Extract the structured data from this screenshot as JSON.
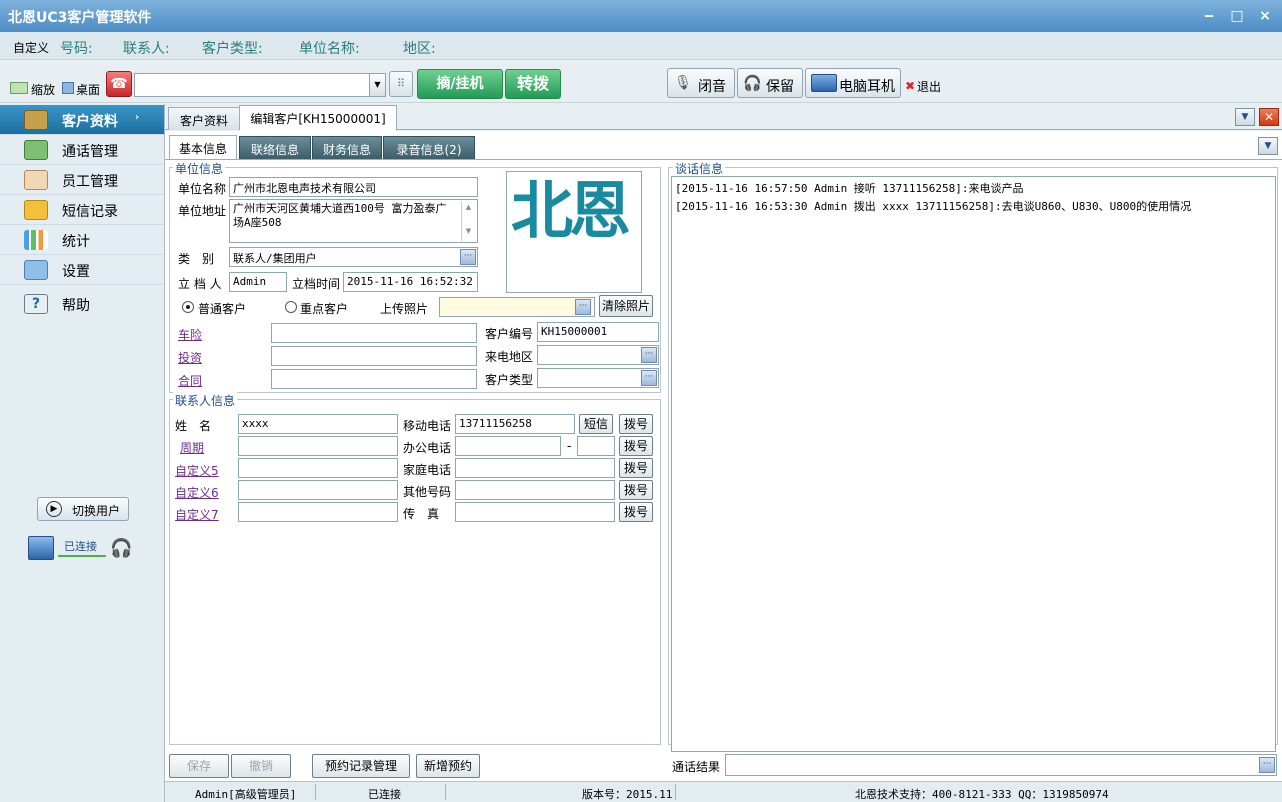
{
  "app": {
    "title": "北恩UC3客户管理软件"
  },
  "window_controls": {
    "minimize": "‒",
    "maximize": "□",
    "close": "×"
  },
  "query_bar": {
    "custom_label": "自定义",
    "fields": [
      "号码:",
      "联系人:",
      "客户类型:",
      "单位名称:",
      "地区:"
    ]
  },
  "toolbar": {
    "zoom_label": "缩放",
    "desktop_label": "桌面",
    "dial_value": "",
    "pickup_hangup": "摘/挂机",
    "transfer": "转拨",
    "mute": "闭音",
    "hold": "保留",
    "pc_headset": "电脑耳机",
    "exit": "退出"
  },
  "sidebar": {
    "items": [
      {
        "label": "客户资料",
        "icon": "customer-card-icon",
        "active": true
      },
      {
        "label": "通话管理",
        "icon": "call-management-icon"
      },
      {
        "label": "员工管理",
        "icon": "staff-icon"
      },
      {
        "label": "短信记录",
        "icon": "envelope-icon"
      },
      {
        "label": "统计",
        "icon": "bar-chart-icon"
      },
      {
        "label": "设置",
        "icon": "settings-icon"
      },
      {
        "label": "帮助",
        "icon": "help-icon"
      }
    ],
    "switch_user": "切换用户",
    "connection_status": "已连接"
  },
  "doc_tabs": [
    "客户资料",
    "编辑客户[KH15000001]"
  ],
  "sub_tabs": [
    "基本信息",
    "联络信息",
    "财务信息",
    "录音信息(2)"
  ],
  "unit_info": {
    "title": "单位信息",
    "unit_name_label": "单位名称",
    "unit_name": "广州市北恩电声技术有限公司",
    "address_label": "单位地址",
    "address": "广州市天河区黄埔大道西100号 富力盈泰广场A座508",
    "category_label": "类　别",
    "category": "联系人/集团用户",
    "creator_label": "立 档 人",
    "creator": "Admin",
    "created_time_label": "立档时间",
    "created_time": "2015-11-16 16:52:32",
    "logo_text": "北恩",
    "radio_normal": "普通客户",
    "radio_key": "重点客户",
    "upload_photo_label": "上传照片",
    "clear_photo": "清除照片",
    "link_car_insurance": "车险",
    "link_investment": "投资",
    "link_contract": "合同",
    "customer_no_label": "客户编号",
    "customer_no": "KH15000001",
    "caller_area_label": "来电地区",
    "customer_type_label": "客户类型"
  },
  "contact_info": {
    "title": "联系人信息",
    "name_label": "姓　名",
    "name": "xxxx",
    "mobile_label": "移动电话",
    "mobile": "13711156258",
    "sms_button": "短信",
    "dial_button": "拨号",
    "cycle_label": "周期",
    "office_label": "办公电话",
    "dash": "-",
    "custom5_label": "自定义5",
    "home_label": "家庭电话",
    "custom6_label": "自定义6",
    "other_label": "其他号码",
    "custom7_label": "自定义7",
    "fax_label": "传　真"
  },
  "conversation": {
    "title": "谈话信息",
    "lines": [
      "[2015-11-16 16:57:50 Admin 接听  13711156258]:来电谈产品",
      "[2015-11-16 16:53:30 Admin 拨出 xxxx 13711156258]:去电谈U860、U830、U800的使用情况"
    ],
    "call_result_label": "通话结果"
  },
  "bottom_buttons": {
    "save": "保存",
    "undo": "撤销",
    "appointment_mgmt": "预约记录管理",
    "new_appointment": "新增预约"
  },
  "status_bar": {
    "user": "Admin[高级管理员]",
    "connection": "已连接",
    "version": "版本号：2015.11",
    "support": "北恩技术支持：400-8121-333 QQ：1319850974"
  }
}
